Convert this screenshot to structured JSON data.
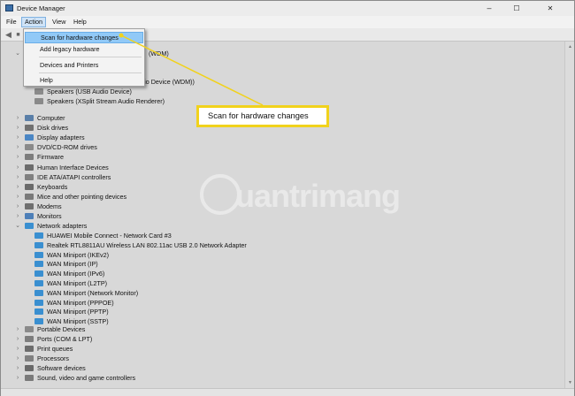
{
  "window": {
    "title": "Device Manager",
    "controls": {
      "minimize": "–",
      "maximize": "☐",
      "close": "✕"
    }
  },
  "menubar": {
    "items": [
      "File",
      "Action",
      "View",
      "Help"
    ],
    "active": "Action"
  },
  "action_menu": {
    "items": [
      {
        "label": "Scan for hardware changes",
        "highlighted": true
      },
      {
        "label": "Add legacy hardware"
      },
      {
        "label": "Devices and Printers"
      },
      {
        "label": "Help"
      }
    ]
  },
  "tree": {
    "audio_partial": "(WDM)",
    "audio_children": [
      "Microphone (Voicemod Virtual Audio Device (WDM))",
      "Speakers (USB Audio Device)",
      "Speakers (XSplit Stream Audio Renderer)"
    ],
    "categories_a": [
      "Computer",
      "Disk drives",
      "Display adapters",
      "DVD/CD-ROM drives",
      "Firmware",
      "Human Interface Devices",
      "IDE ATA/ATAPI controllers",
      "Keyboards",
      "Mice and other pointing devices",
      "Modems",
      "Monitors"
    ],
    "network_adapters": {
      "label": "Network adapters",
      "children": [
        "HUAWEI Mobile Connect - Network Card #3",
        "Realtek RTL8811AU Wireless LAN 802.11ac USB 2.0 Network Adapter",
        "WAN Miniport (IKEv2)",
        "WAN Miniport (IP)",
        "WAN Miniport (IPv6)",
        "WAN Miniport (L2TP)",
        "WAN Miniport (Network Monitor)",
        "WAN Miniport (PPPOE)",
        "WAN Miniport (PPTP)",
        "WAN Miniport (SSTP)"
      ]
    },
    "categories_b": [
      "Portable Devices",
      "Ports (COM & LPT)",
      "Print queues",
      "Processors",
      "Software devices",
      "Sound, video and game controllers"
    ]
  },
  "callout": {
    "text": "Scan for hardware changes",
    "border_color": "#f1d21c"
  },
  "watermark": {
    "text": "uantrimang"
  },
  "colors": {
    "accent_blue": "#91c9f7",
    "callout_yellow": "#f1d21c",
    "network_icon": "#3a8fd0"
  },
  "icons": {
    "toolbar": [
      "back-arrow-icon",
      "forward-arrow-icon"
    ],
    "tree": "device-category-icon"
  }
}
